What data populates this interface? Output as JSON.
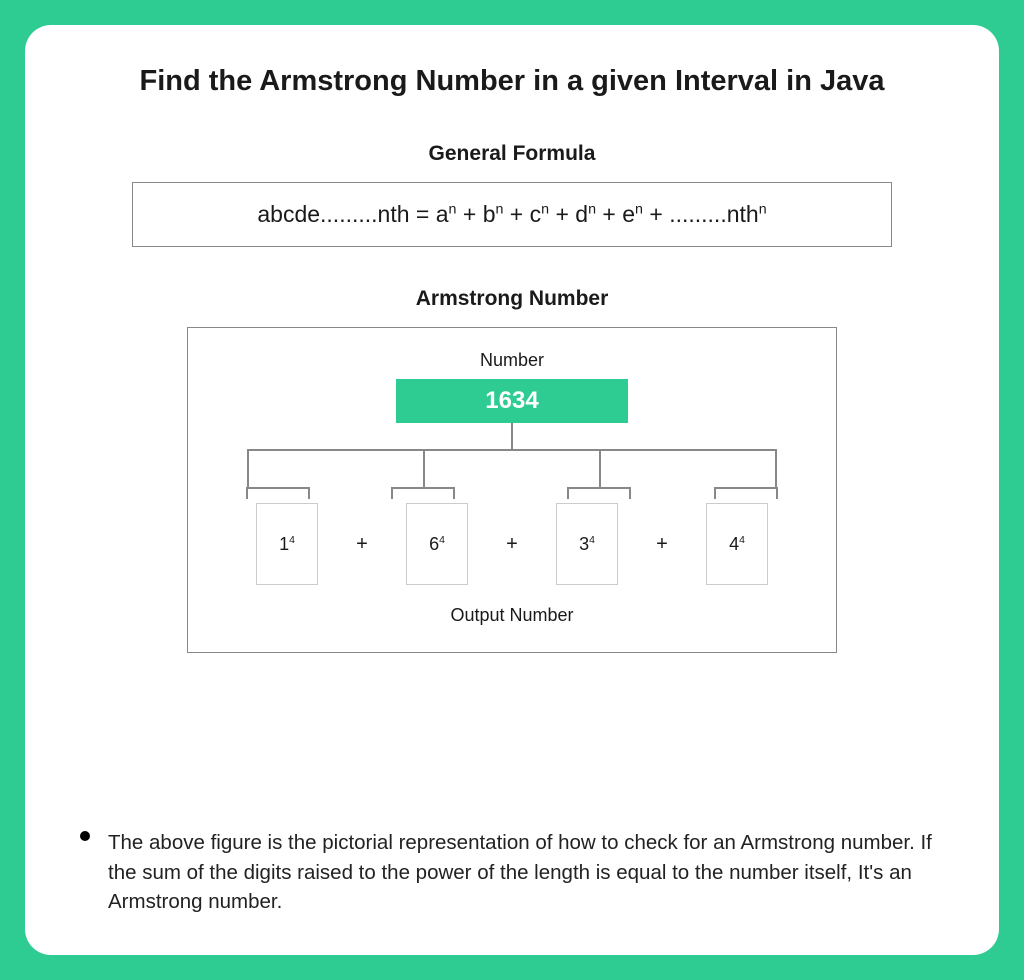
{
  "title": "Find the Armstrong Number in a given Interval in Java",
  "formula": {
    "heading": "General Formula",
    "lhs": "abcde.........nth",
    "eq": " = ",
    "terms": [
      "a",
      "b",
      "c",
      "d",
      "e"
    ],
    "exp": "n",
    "tail": ".........nth",
    "plus": " + "
  },
  "diagram": {
    "heading": "Armstrong Number",
    "numberLabel": "Number",
    "numberValue": "1634",
    "terms": [
      {
        "base": "1",
        "exp": "4"
      },
      {
        "base": "6",
        "exp": "4"
      },
      {
        "base": "3",
        "exp": "4"
      },
      {
        "base": "4",
        "exp": "4"
      }
    ],
    "plus": "+",
    "outputLabel": "Output Number"
  },
  "footer": "The above figure is the pictorial representation of how to check for an Armstrong number. If the sum of the digits raised to the power of the length is equal to the number itself, It's an Armstrong number."
}
